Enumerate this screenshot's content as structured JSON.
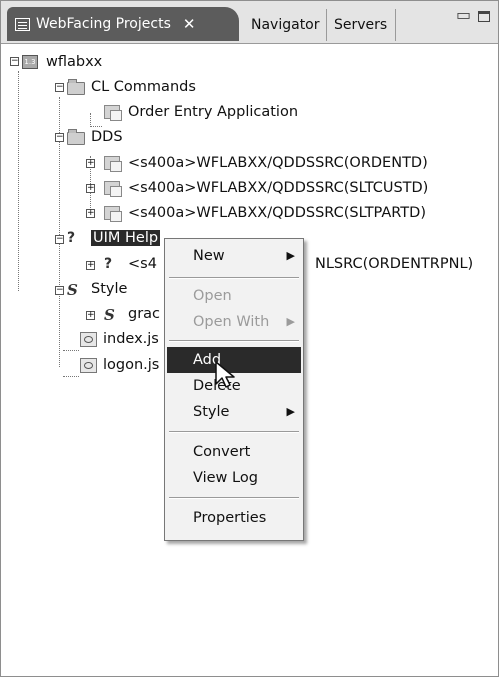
{
  "tabs": {
    "active_label": "WebFacing Projects",
    "close_glyph": "✕",
    "navigator": "Navigator",
    "servers": "Servers"
  },
  "window_controls": {
    "minimize": "▭",
    "maximize": ""
  },
  "tree": {
    "root": "wflabxx",
    "cl_commands": "CL Commands",
    "order_entry": "Order Entry Application",
    "dds": "DDS",
    "dds_items": [
      "<s400a>WFLABXX/QDDSSRC(ORDENTD)",
      "<s400a>WFLABXX/QDDSSRC(SLTCUSTD)",
      "<s400a>WFLABXX/QDDSSRC(SLTPARTD)"
    ],
    "uim_help": "UIM Help",
    "uim_child_prefix": "<s4",
    "uim_child_suffix": "NLSRC(ORDENTRPNL)",
    "style": "Style",
    "style_child": "grac",
    "index_file": "index.js",
    "logon_file": "logon.js"
  },
  "context_menu": {
    "new": "New",
    "open": "Open",
    "open_with": "Open With",
    "add": "Add",
    "delete": "Delete",
    "style": "Style",
    "convert": "Convert",
    "view_log": "View Log",
    "properties": "Properties",
    "submenu_arrow": "▶"
  },
  "icons": {
    "help_glyph": "?",
    "style_glyph": "S",
    "expand_plus": "+",
    "collapse_minus": "−"
  }
}
